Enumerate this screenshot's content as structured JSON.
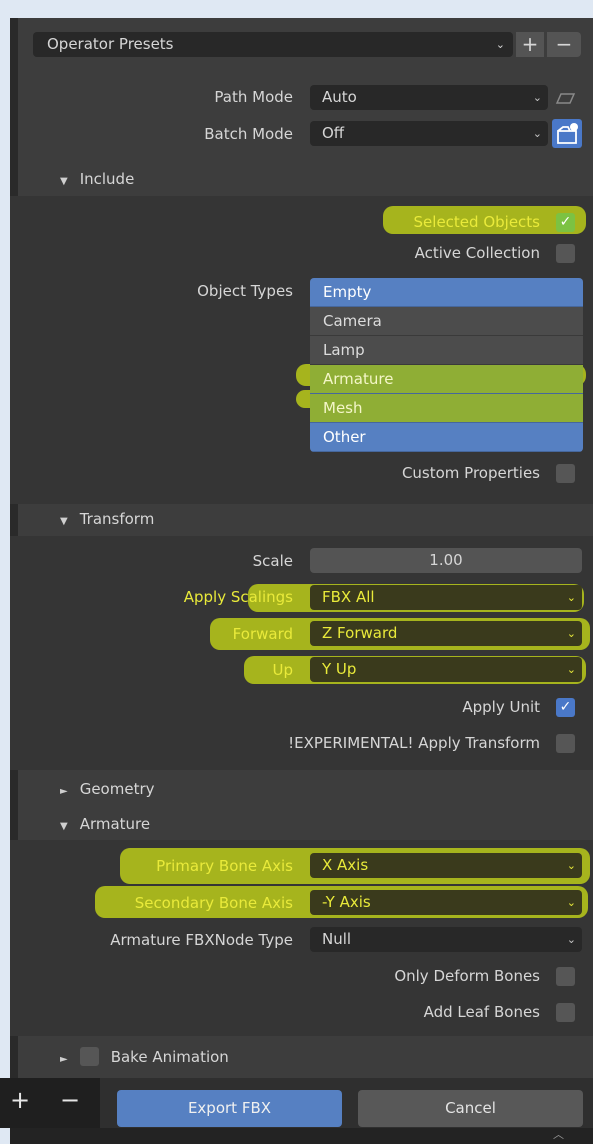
{
  "presets": {
    "label": "Operator Presets",
    "add": "+",
    "remove": "−"
  },
  "path_mode": {
    "label": "Path Mode",
    "value": "Auto"
  },
  "batch_mode": {
    "label": "Batch Mode",
    "value": "Off"
  },
  "include": {
    "header": "Include",
    "selected_objects": "Selected Objects",
    "active_collection": "Active Collection",
    "object_types_label": "Object Types",
    "object_types": [
      "Empty",
      "Camera",
      "Lamp",
      "Armature",
      "Mesh",
      "Other"
    ],
    "custom_properties": "Custom Properties"
  },
  "transform": {
    "header": "Transform",
    "scale_label": "Scale",
    "scale_value": "1.00",
    "apply_scalings_label": "Apply Scalings",
    "apply_scalings_value": "FBX All",
    "forward_label": "Forward",
    "forward_value": "Z Forward",
    "up_label": "Up",
    "up_value": "Y Up",
    "apply_unit": "Apply Unit",
    "apply_transform": "!EXPERIMENTAL! Apply Transform"
  },
  "geometry": {
    "header": "Geometry"
  },
  "armature": {
    "header": "Armature",
    "primary_label": "Primary Bone Axis",
    "primary_value": "X Axis",
    "secondary_label": "Secondary Bone Axis",
    "secondary_value": "-Y Axis",
    "node_type_label": "Armature FBXNode Type",
    "node_type_value": "Null",
    "only_deform": "Only Deform Bones",
    "add_leaf": "Add Leaf Bones"
  },
  "bake": {
    "header": "Bake Animation"
  },
  "footer": {
    "export": "Export FBX",
    "cancel": "Cancel",
    "add": "+",
    "remove": "−"
  },
  "colors": {
    "accent": "#5680c2",
    "highlight": "#d7eb14",
    "check_green": "#7cc242"
  }
}
